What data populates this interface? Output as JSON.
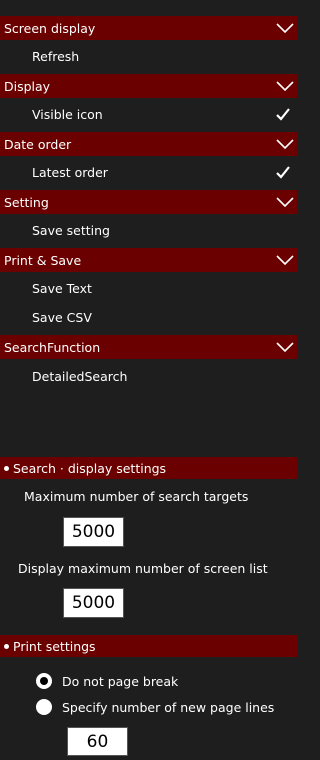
{
  "menu": {
    "screen_display": {
      "title": "Screen display",
      "items": [
        "Refresh"
      ]
    },
    "display": {
      "title": "Display",
      "items": [
        "Visible icon"
      ]
    },
    "date_order": {
      "title": "Date order",
      "items": [
        "Latest order"
      ]
    },
    "setting": {
      "title": "Setting",
      "items": [
        "Save setting"
      ]
    },
    "print_save": {
      "title": "Print & Save",
      "items": [
        "Save Text",
        "Save CSV"
      ]
    },
    "search_function": {
      "title": "SearchFunction",
      "items": [
        "DetailedSearch"
      ]
    }
  },
  "checked": {
    "visible_icon": true,
    "latest_order": true
  },
  "search_display_settings": {
    "title": "Search · display settings",
    "max_search_targets_label": "Maximum number of search targets",
    "max_search_targets_value": "5000",
    "display_max_list_label": "Display maximum number of screen list",
    "display_max_list_value": "5000"
  },
  "print_settings": {
    "title": "Print settings",
    "options": [
      "Do not page break",
      "Specify number of new page lines"
    ],
    "selected_option": "Do not page break",
    "page_lines_value": "60"
  },
  "colors": {
    "background": "#1e1e1e",
    "header": "#6b0000",
    "text": "#ffffff"
  }
}
